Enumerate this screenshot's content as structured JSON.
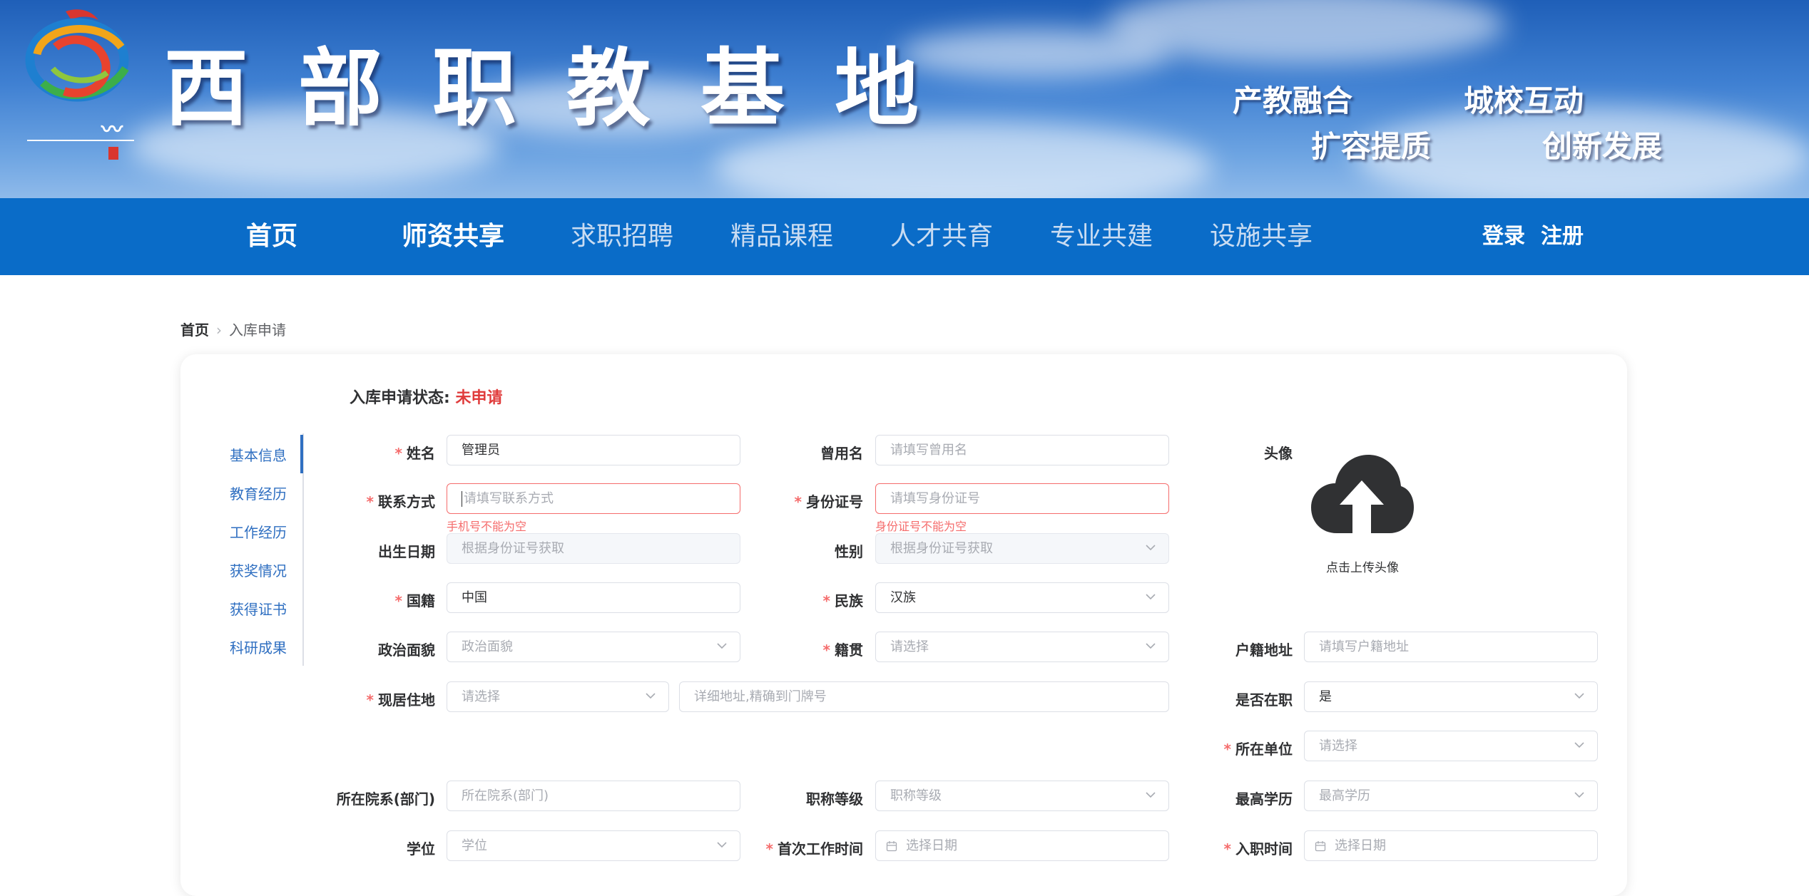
{
  "header": {
    "title": "西部职教基地",
    "slogans": [
      "产教融合",
      "城校互动",
      "扩容提质",
      "创新发展"
    ]
  },
  "nav": {
    "items": [
      {
        "label": "首页",
        "active": true
      },
      {
        "label": "师资共享",
        "active": true
      },
      {
        "label": "求职招聘",
        "active": false
      },
      {
        "label": "精品课程",
        "active": false
      },
      {
        "label": "人才共育",
        "active": false
      },
      {
        "label": "专业共建",
        "active": false
      },
      {
        "label": "设施共享",
        "active": false
      }
    ],
    "login": "登录",
    "register": "注册"
  },
  "breadcrumb": {
    "home": "首页",
    "current": "入库申请"
  },
  "status": {
    "label": "入库申请状态:",
    "value": "未申请"
  },
  "side_tabs": [
    "基本信息",
    "教育经历",
    "工作经历",
    "获奖情况",
    "获得证书",
    "科研成果"
  ],
  "form": {
    "name": {
      "label": "姓名",
      "value": "管理员"
    },
    "former_name": {
      "label": "曾用名",
      "placeholder": "请填写曾用名"
    },
    "avatar": {
      "label": "头像",
      "upload_text": "点击上传头像"
    },
    "contact": {
      "label": "联系方式",
      "placeholder": "请填写联系方式",
      "error": "手机号不能为空"
    },
    "id_number": {
      "label": "身份证号",
      "placeholder": "请填写身份证号",
      "error": "身份证号不能为空"
    },
    "birth_date": {
      "label": "出生日期",
      "placeholder": "根据身份证号获取"
    },
    "gender": {
      "label": "性别",
      "placeholder": "根据身份证号获取"
    },
    "nationality": {
      "label": "国籍",
      "value": "中国"
    },
    "ethnicity": {
      "label": "民族",
      "value": "汉族"
    },
    "political": {
      "label": "政治面貌",
      "placeholder": "政治面貌"
    },
    "native_place": {
      "label": "籍贯",
      "placeholder": "请选择"
    },
    "household_address": {
      "label": "户籍地址",
      "placeholder": "请填写户籍地址"
    },
    "residence": {
      "label": "现居住地",
      "placeholder": "请选择",
      "detail_placeholder": "详细地址,精确到门牌号"
    },
    "employed": {
      "label": "是否在职",
      "value": "是"
    },
    "employer": {
      "label": "所在单位",
      "placeholder": "请选择"
    },
    "department": {
      "label": "所在院系(部门)",
      "placeholder": "所在院系(部门)"
    },
    "title_level": {
      "label": "职称等级",
      "placeholder": "职称等级"
    },
    "education": {
      "label": "最高学历",
      "placeholder": "最高学历"
    },
    "degree": {
      "label": "学位",
      "placeholder": "学位"
    },
    "first_work_time": {
      "label": "首次工作时间",
      "placeholder": "选择日期"
    },
    "hire_time": {
      "label": "入职时间",
      "placeholder": "选择日期"
    }
  }
}
